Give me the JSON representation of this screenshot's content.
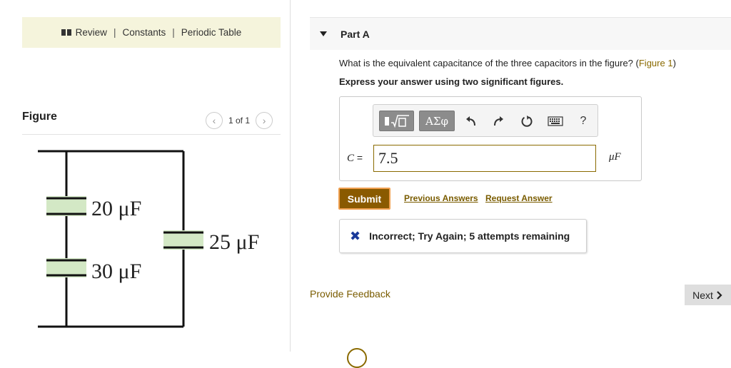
{
  "resources": {
    "review": "Review",
    "constants": "Constants",
    "periodic_table": "Periodic Table",
    "separator": "|"
  },
  "figure": {
    "label": "Figure",
    "pager_text": "1 of 1",
    "capacitors": [
      "20 μF",
      "30 μF",
      "25 μF"
    ]
  },
  "part": {
    "title": "Part A",
    "question": "What is the equivalent capacitance of the three capacitors in the figure? (",
    "figure_link": "Figure 1",
    "question_end": ")",
    "instruction": "Express your answer using two significant figures."
  },
  "toolbar": {
    "greek_label": "ΑΣφ",
    "help_label": "?",
    "icons": [
      "templates-icon",
      "undo-icon",
      "redo-icon",
      "reset-icon",
      "keyboard-icon",
      "help-icon"
    ]
  },
  "answer": {
    "variable": "C",
    "equals": "=",
    "value": "7.5",
    "unit": "μF"
  },
  "actions": {
    "submit": "Submit",
    "previous_answers": "Previous Answers",
    "request_answer": "Request Answer"
  },
  "feedback": {
    "message": "Incorrect; Try Again; 5 attempts remaining"
  },
  "footer": {
    "provide_feedback": "Provide Feedback",
    "next": "Next"
  },
  "colors": {
    "accent": "#8a5a00",
    "link": "#7a5c00",
    "resources_bg": "#f5f4dc",
    "capacitor_fill": "#d3e8c5",
    "incorrect_icon": "#1a3a9a"
  }
}
